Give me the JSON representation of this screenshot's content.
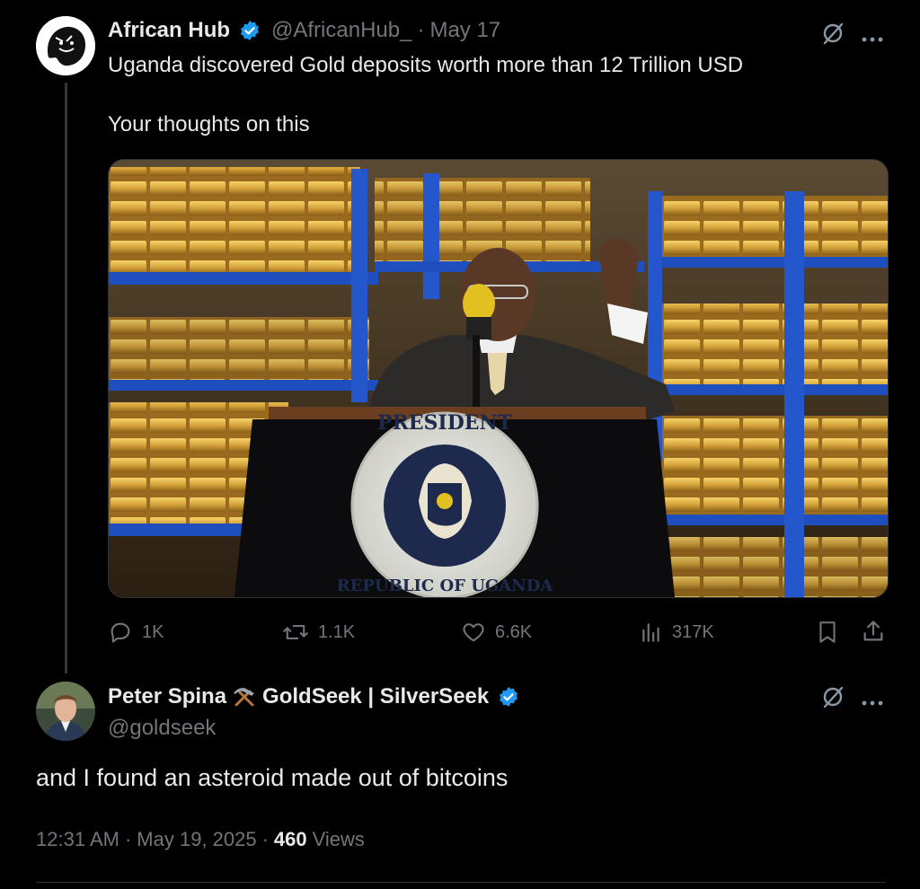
{
  "tweet": {
    "author_name": "African Hub",
    "author_handle": "@AfricanHub_",
    "date_sep": "·",
    "date": "May 17",
    "text_line1": "Uganda discovered Gold deposits worth more than 12 Trillion USD",
    "text_line2": "Your thoughts on this",
    "image": {
      "seal_text_top": "PRESIDENT",
      "seal_text_bottom": "REPUBLIC OF UGANDA"
    },
    "actions": {
      "replies": "1K",
      "reposts": "1.1K",
      "likes": "6.6K",
      "views": "317K"
    }
  },
  "reply": {
    "author_name": "Peter Spina",
    "author_name_suffix": "GoldSeek | SilverSeek",
    "author_handle": "@goldseek",
    "text": "and I found an asteroid made out of bitcoins",
    "time": "12:31 AM",
    "sep1": "·",
    "date": "May 19, 2025",
    "sep2": "·",
    "views_count": "460",
    "views_label": "Views"
  },
  "icons": {
    "grok": "grok-icon",
    "more": "more-icon",
    "reply": "reply-icon",
    "repost": "repost-icon",
    "like": "heart-icon",
    "views": "views-icon",
    "bookmark": "bookmark-icon",
    "share": "share-icon",
    "verified": "verified-badge-icon",
    "hammer": "hammer-pick-icon"
  },
  "colors": {
    "background": "#000000",
    "text": "#e7e9ea",
    "muted": "#71767b",
    "verified": "#1d9bf0"
  }
}
